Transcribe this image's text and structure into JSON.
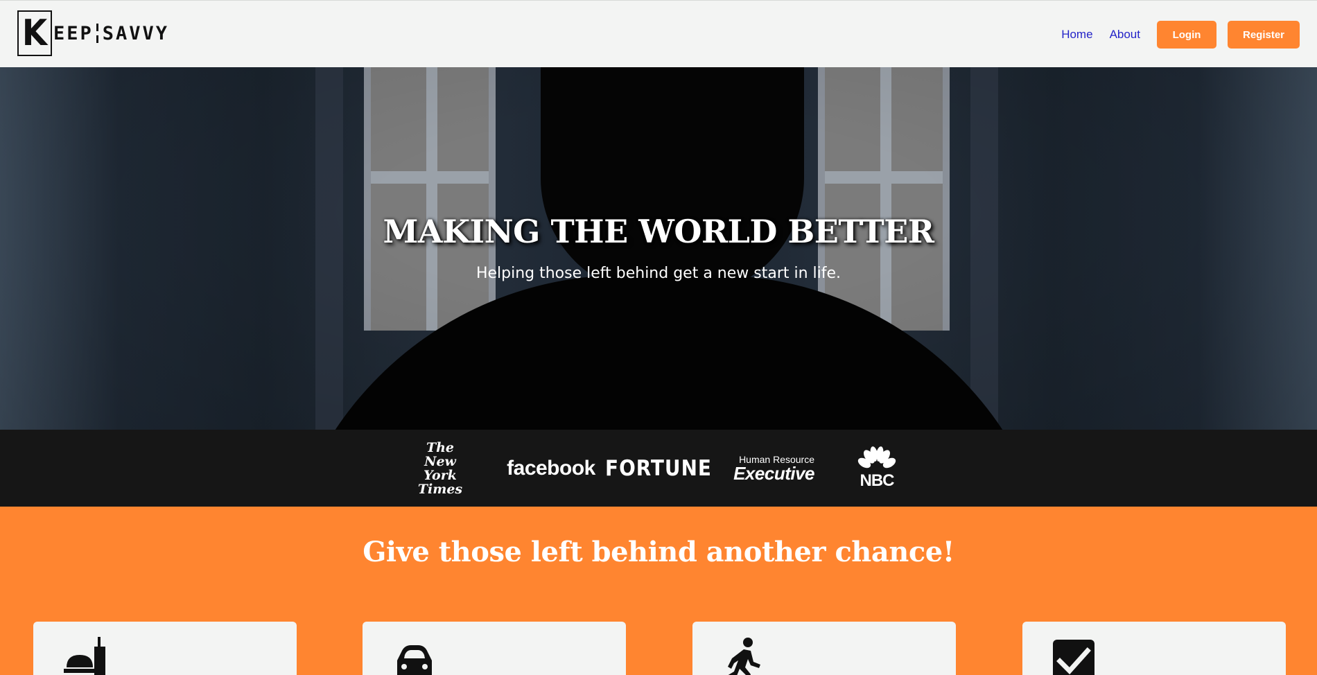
{
  "header": {
    "logo": {
      "initial": "K",
      "part1": "EEP",
      "part2": "SAVVY"
    },
    "nav": {
      "home": "Home",
      "about": "About",
      "login": "Login",
      "register": "Register"
    }
  },
  "hero": {
    "title": "MAKING THE WORLD BETTER",
    "subtitle": "Helping those left behind get a new start in life."
  },
  "press": {
    "nyt_lines": [
      "The",
      "New York",
      "Times"
    ],
    "facebook": "facebook",
    "fortune": "FORTUNE",
    "hre_small": "Human Resource",
    "hre_big": "Executive",
    "nbc": "NBC"
  },
  "cta": {
    "title": "Give those left behind another chance!",
    "cards": [
      {
        "icon": "food-icon"
      },
      {
        "icon": "car-icon"
      },
      {
        "icon": "walking-person-icon"
      },
      {
        "icon": "checkbox-icon"
      }
    ]
  },
  "colors": {
    "accent": "#ff8530",
    "nav_link": "#2424c8",
    "press_band": "#161616"
  }
}
